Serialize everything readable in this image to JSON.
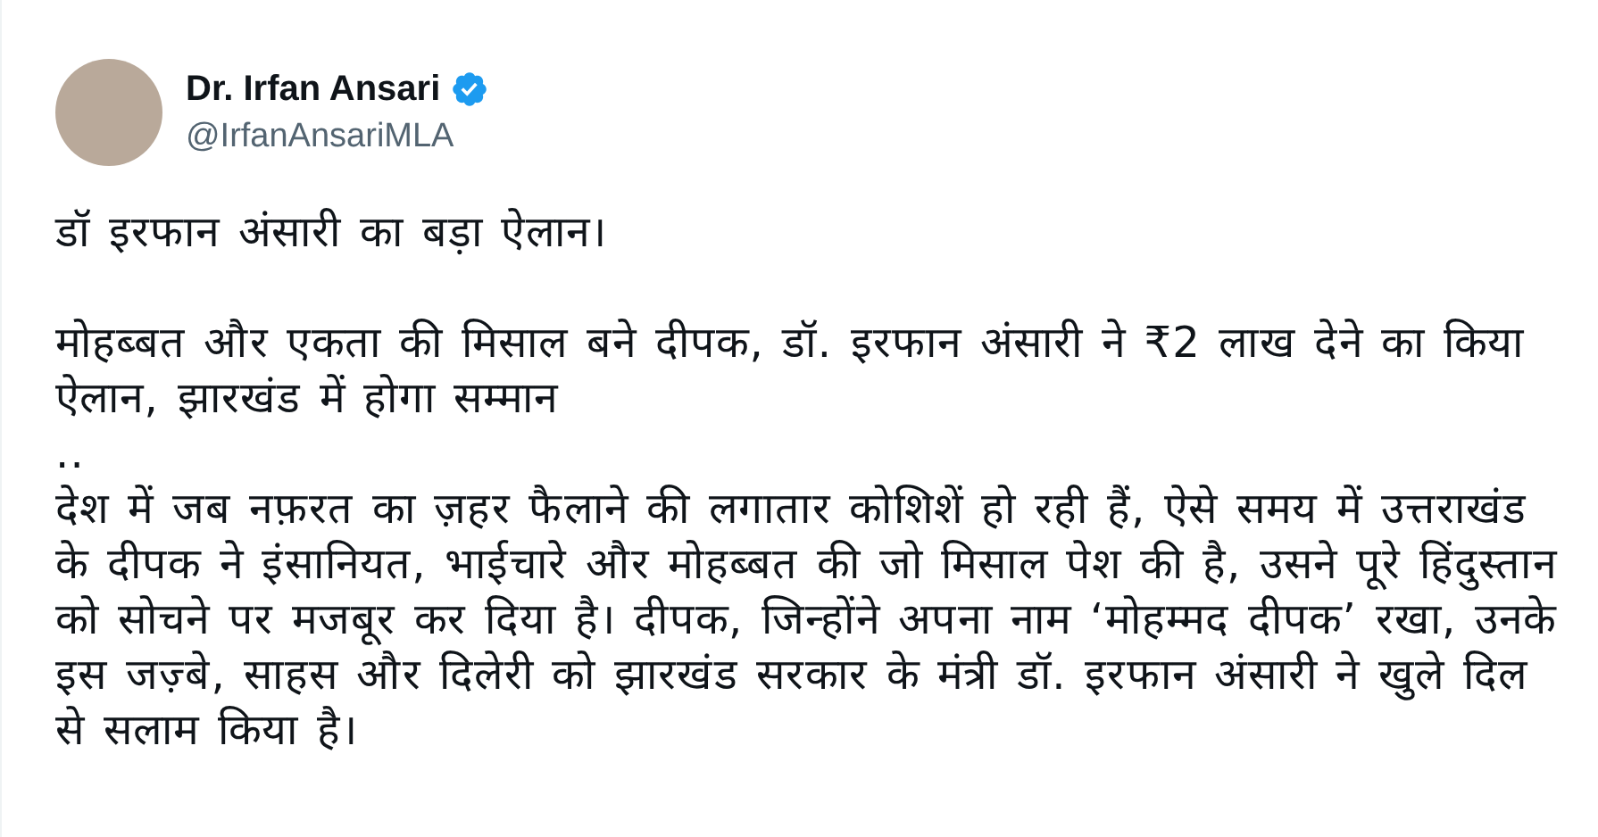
{
  "author": {
    "name": "Dr. Irfan Ansari",
    "handle": "@IrfanAnsariMLA",
    "verified": true
  },
  "paragraphs": [
    "डॉ इरफान अंसारी का बड़ा ऐलान।",
    "मोहब्बत और एकता की मिसाल बने दीपक, डॉ. इरफान अंसारी ने ₹2 लाख देने का किया ऐलान, झारखंड में होगा सम्मान",
    "..",
    "देश में जब नफ़रत का ज़हर फैलाने की लगातार कोशिशें हो रही हैं, ऐसे समय में उत्तराखंड के दीपक ने इंसानियत, भाईचारे और मोहब्बत की जो मिसाल पेश की है, उसने पूरे हिंदुस्तान को सोचने पर मजबूर कर दिया है। दीपक, जिन्होंने अपना नाम ‘मोहम्मद दीपक’ रखा, उनके इस जज़्बे, साहस और दिलेरी को झारखंड सरकार के मंत्री डॉ. इरफान अंसारी ने खुले दिल से सलाम किया है।"
  ]
}
